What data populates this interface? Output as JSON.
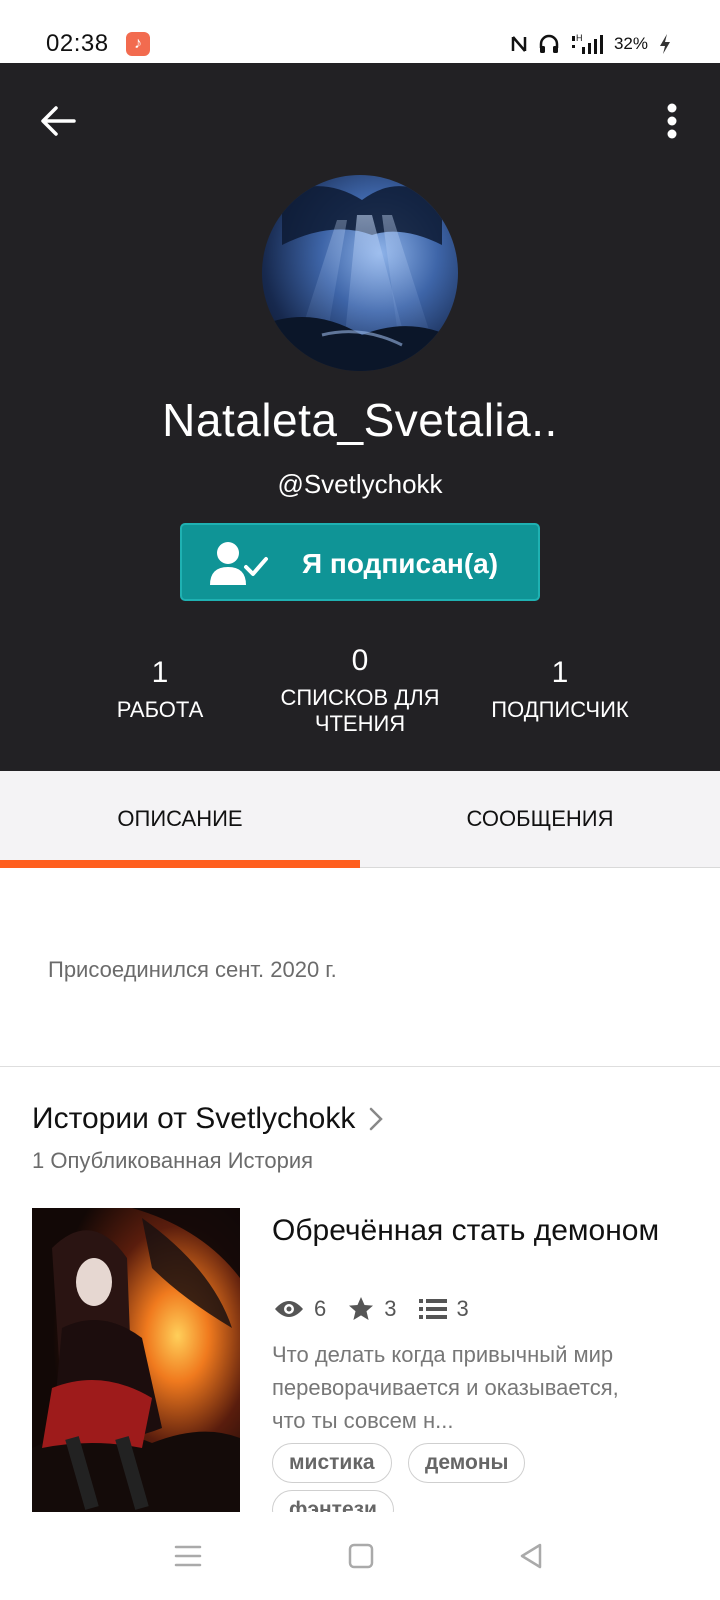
{
  "status_bar": {
    "time": "02:38",
    "battery": "32%",
    "icons": [
      "music-note-icon",
      "nfc-icon",
      "headphones-icon",
      "signal-icon",
      "battery-charging-icon"
    ]
  },
  "profile": {
    "display_name": "Nataleta_Svetalia..",
    "handle": "@Svetlychokk",
    "follow_button": "Я подписан(а)",
    "stats": [
      {
        "value": "1",
        "label": "РАБОТА"
      },
      {
        "value": "0",
        "label": "СПИСКОВ ДЛЯ ЧТЕНИЯ"
      },
      {
        "value": "1",
        "label": "ПОДПИСЧИК"
      }
    ]
  },
  "tabs": [
    {
      "label": "ОПИСАНИЕ",
      "active": true
    },
    {
      "label": "СООБЩЕНИЯ",
      "active": false
    }
  ],
  "about": {
    "joined": "Присоединился сент. 2020 г."
  },
  "stories": {
    "title": "Истории от Svetlychokk",
    "subtitle": "1 Опубликованная История",
    "items": [
      {
        "title": "Обречённая стать демоном",
        "reads": "6",
        "votes": "3",
        "parts": "3",
        "description": "Что делать когда привычный мир переворачивается и оказывается, что ты совсем н...",
        "tags": [
          "мистика",
          "демоны",
          "фэнтези"
        ]
      }
    ]
  },
  "colors": {
    "header_bg": "#222124",
    "follow_btn": "#0f9496",
    "tab_indicator": "#ff5f1f"
  }
}
